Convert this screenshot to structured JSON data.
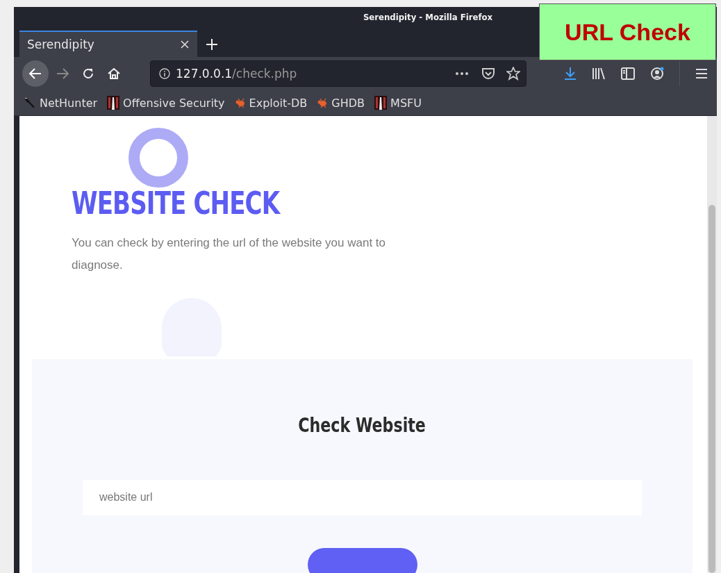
{
  "window": {
    "title": "Serendipity - Mozilla Firefox"
  },
  "tabs": [
    {
      "label": "Serendipity",
      "selected": true
    }
  ],
  "address_bar": {
    "host": "127.0.0.1",
    "path": "/check.php"
  },
  "bookmarks": [
    {
      "label": "NetHunter",
      "kind": "dragon"
    },
    {
      "label": "Offensive Security",
      "kind": "tower"
    },
    {
      "label": "Exploit-DB",
      "kind": "bug"
    },
    {
      "label": "GHDB",
      "kind": "bug"
    },
    {
      "label": "MSFU",
      "kind": "tower"
    }
  ],
  "annotation": {
    "text": "URL Check"
  },
  "page": {
    "heading": "WEBSITE CHECK",
    "description": "You can check by entering the url of the website you want to diagnose.",
    "form_title": "Check Website",
    "url_field": {
      "placeholder": "website url"
    }
  }
}
